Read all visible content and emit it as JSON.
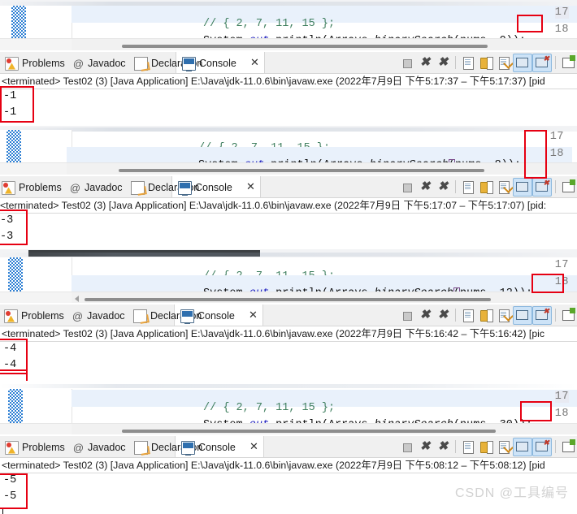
{
  "meta": {
    "app": "Eclipse IDE",
    "watermark": "CSDN @工具编号"
  },
  "code": {
    "line17_no": "17",
    "line18_no": "18",
    "line17_text": "// { 2, 7, 11, 15 };",
    "prefix": "System.",
    "out": "out",
    "mid": ".println(Arrays.",
    "method": "binarySearch",
    "open_paren": "(",
    "args_prefix": "nums, ",
    "close": ")",
    "semi": ");"
  },
  "tabs": [
    {
      "label": "Problems",
      "icon": "problems-icon",
      "active": false
    },
    {
      "label": "Javadoc",
      "icon": "javadoc-at-icon",
      "active": false
    },
    {
      "label": "Declaration",
      "icon": "declaration-icon",
      "active": false
    },
    {
      "label": "Console",
      "icon": "console-icon",
      "active": true
    }
  ],
  "tab_close": "✕",
  "toolbar": [
    {
      "name": "terminate-button",
      "icon": "stop-square-icon"
    },
    {
      "name": "remove-launch-button",
      "icon": "x-icon"
    },
    {
      "name": "remove-all-terminated-button",
      "icon": "double-x-icon"
    },
    {
      "name": "clear-console-button",
      "icon": "clear-page-icon"
    },
    {
      "name": "scroll-lock-button",
      "icon": "lock-icon"
    },
    {
      "name": "word-wrap-button",
      "icon": "wrap-arrow-icon"
    },
    {
      "name": "show-console-on-output-button",
      "icon": "monitor-out-icon"
    },
    {
      "name": "show-console-on-error-button",
      "icon": "monitor-err-icon"
    },
    {
      "name": "open-console-button",
      "icon": "new-console-icon"
    }
  ],
  "panels": [
    {
      "id": "panel-1",
      "arg": "0)",
      "arg_plain": "0",
      "cmdline": "<terminated> Test02 (3) [Java Application] E:\\Java\\jdk-11.0.6\\bin\\javaw.exe  (2022年7月9日 下午5:17:37 – 下午5:17:37) [pid",
      "output": [
        "-1",
        "-1"
      ],
      "highlight_line": "17"
    },
    {
      "id": "panel-2",
      "arg": "8)",
      "arg_plain": "8",
      "cmdline": "<terminated> Test02 (3) [Java Application] E:\\Java\\jdk-11.0.6\\bin\\javaw.exe  (2022年7月9日 下午5:17:07 – 下午5:17:07) [pid:",
      "output": [
        "-3",
        "-3"
      ],
      "highlight_line": "18"
    },
    {
      "id": "panel-3",
      "arg": "12)",
      "arg_plain": "12",
      "cmdline": "<terminated> Test02 (3) [Java Application] E:\\Java\\jdk-11.0.6\\bin\\javaw.exe  (2022年7月9日 下午5:16:42 – 下午5:16:42) [pic",
      "output": [
        "-4",
        "-4"
      ],
      "highlight_line": "18"
    },
    {
      "id": "panel-4",
      "arg": "30)",
      "arg_plain": "30",
      "cmdline": "<terminated> Test02 (3) [Java Application] E:\\Java\\jdk-11.0.6\\bin\\javaw.exe  (2022年7月9日 下午5:08:12 – 下午5:08:12) [pid",
      "output": [
        "-5",
        "-5"
      ],
      "highlight_line": "17"
    }
  ]
}
